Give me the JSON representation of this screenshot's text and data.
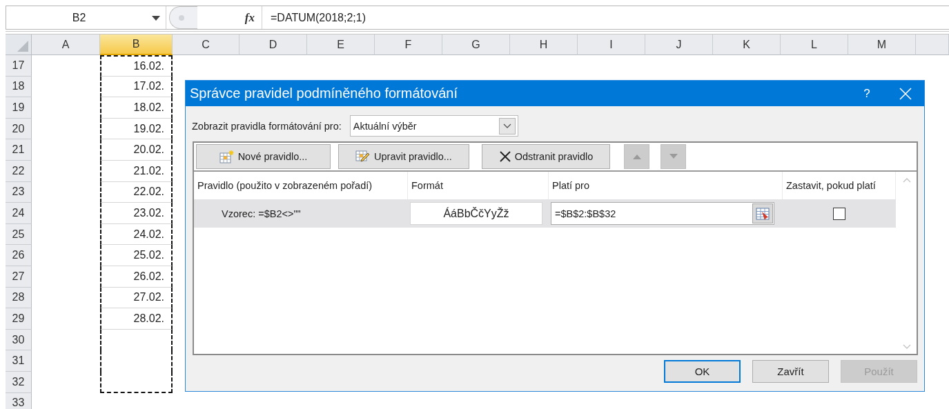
{
  "formula_bar": {
    "name_box": "B2",
    "function_label": "fx",
    "formula": "=DATUM(2018;2;1)"
  },
  "sheet": {
    "columns": [
      {
        "label": "A",
        "selected": false
      },
      {
        "label": "B",
        "selected": true
      },
      {
        "label": "C",
        "selected": false
      },
      {
        "label": "D",
        "selected": false
      },
      {
        "label": "E",
        "selected": false
      },
      {
        "label": "F",
        "selected": false
      },
      {
        "label": "G",
        "selected": false
      },
      {
        "label": "H",
        "selected": false
      },
      {
        "label": "I",
        "selected": false
      },
      {
        "label": "J",
        "selected": false
      },
      {
        "label": "K",
        "selected": false
      },
      {
        "label": "L",
        "selected": false
      },
      {
        "label": "M",
        "selected": false
      }
    ],
    "rows": [
      {
        "number": "17",
        "b": "16.02.",
        "copied": true
      },
      {
        "number": "18",
        "b": "17.02.",
        "copied": true
      },
      {
        "number": "19",
        "b": "18.02.",
        "copied": true
      },
      {
        "number": "20",
        "b": "19.02.",
        "copied": true
      },
      {
        "number": "21",
        "b": "20.02.",
        "copied": true
      },
      {
        "number": "22",
        "b": "21.02.",
        "copied": true
      },
      {
        "number": "23",
        "b": "22.02.",
        "copied": true
      },
      {
        "number": "24",
        "b": "23.02.",
        "copied": true
      },
      {
        "number": "25",
        "b": "24.02.",
        "copied": true
      },
      {
        "number": "26",
        "b": "25.02.",
        "copied": true
      },
      {
        "number": "27",
        "b": "26.02.",
        "copied": true
      },
      {
        "number": "28",
        "b": "27.02.",
        "copied": true
      },
      {
        "number": "29",
        "b": "28.02.",
        "copied": true
      },
      {
        "number": "30",
        "copied": true
      },
      {
        "number": "31",
        "copied": true
      },
      {
        "number": "32",
        "copied": true
      },
      {
        "number": "33"
      }
    ]
  },
  "dialog": {
    "title": "Správce pravidel podmíněného formátování",
    "help": "?",
    "show_for_label": "Zobrazit pravidla formátování pro:",
    "show_for_value": "Aktuální výběr",
    "toolbar": [
      {
        "kind": "new",
        "label": "Nové pravidlo...",
        "disabled": false
      },
      {
        "kind": "edit",
        "label": "Upravit pravidlo...",
        "disabled": false
      },
      {
        "kind": "delete",
        "label": "Odstranit pravidlo",
        "disabled": false
      },
      {
        "kind": "up",
        "disabled": true
      },
      {
        "kind": "down",
        "disabled": true
      }
    ],
    "columns": [
      "Pravidlo (použito v zobrazeném pořadí)",
      "Formát",
      "Platí pro",
      "Zastavit, pokud platí"
    ],
    "rules": [
      {
        "rule": "Vzorec: =$B2<>\"\"",
        "format_preview": "ÁáBbČčYyŽž",
        "applies_to": "=$B$2:$B$32",
        "stop": false,
        "selected": true
      }
    ],
    "buttons": [
      {
        "label": "OK",
        "default": true,
        "disabled": false
      },
      {
        "label": "Zavřít",
        "default": false,
        "disabled": false
      },
      {
        "label": "Použít",
        "default": false,
        "disabled": true
      }
    ]
  }
}
